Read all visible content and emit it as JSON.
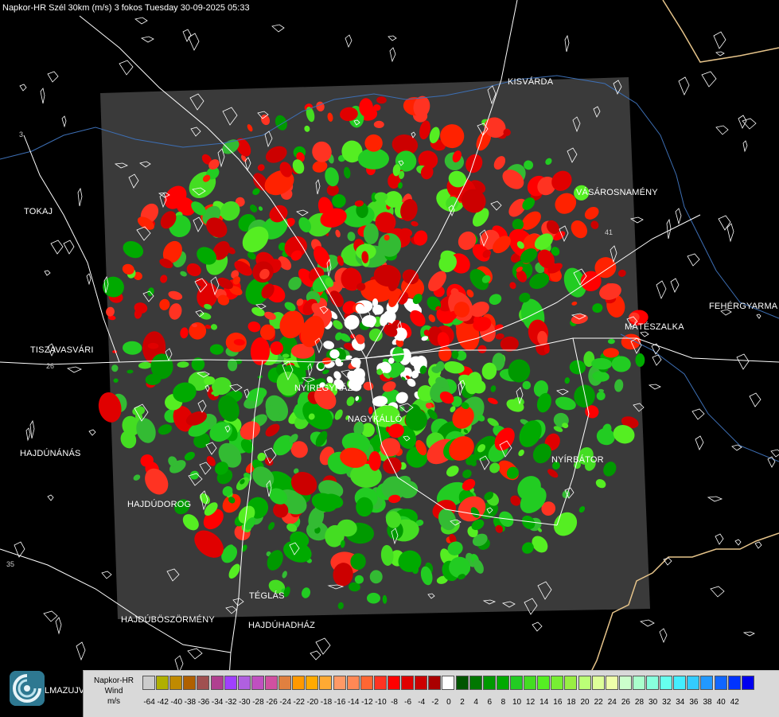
{
  "header": {
    "title": "Napkor-HR Szél 30km (m/s) 3 fokos Tuesday 30-09-2025 05:33"
  },
  "map": {
    "background_color": "#000000",
    "radar_box_color": "#3a3a3a",
    "border_color": "#e6c48a",
    "road_color": "#ffffff",
    "river_color": "#3d6fb5",
    "road_numbers": [
      "26",
      "41",
      "35",
      "3"
    ],
    "cities": [
      {
        "name": "KISVÁRDA"
      },
      {
        "name": "VÁSÁROSNAMÉNY"
      },
      {
        "name": "TOKAJ"
      },
      {
        "name": "FEHÉRGYARMA"
      },
      {
        "name": "MÁTÉSZALKA"
      },
      {
        "name": "TISZAVASVÁRI"
      },
      {
        "name": "NYÍREGYHÁZA"
      },
      {
        "name": "NAGYKÁLLÓ"
      },
      {
        "name": "HAJDÚNÁNÁS"
      },
      {
        "name": "NYÍRBÁTOR"
      },
      {
        "name": "HAJDÚDOROG"
      },
      {
        "name": "TÉGLÁS"
      },
      {
        "name": "HAJDÚBÖSZÖRMÉNY"
      },
      {
        "name": "HAJDÚHADHÁZ"
      }
    ]
  },
  "brand": {
    "logo_icon": "hungaromet-swirl-icon",
    "text": "LMAZUJVAR"
  },
  "legend": {
    "line1": "Napkor-HR",
    "line2": "Wind",
    "line3": "m/s",
    "colors": [
      "#cccccc",
      "#b0b000",
      "#c08a00",
      "#b06000",
      "#a05050",
      "#b04090",
      "#a040ff",
      "#b060e0",
      "#c050c0",
      "#d050a0",
      "#e08040",
      "#ff9900",
      "#ffaa00",
      "#ffaa33",
      "#ff9966",
      "#ff8855",
      "#ff6633",
      "#ff3322",
      "#ff0000",
      "#e00000",
      "#cc0000",
      "#aa0000",
      "#ffffff",
      "#005500",
      "#007700",
      "#009900",
      "#00aa00",
      "#22cc22",
      "#44dd22",
      "#55ee22",
      "#77ee33",
      "#99ee44",
      "#bbff77",
      "#ddff99",
      "#eeffaa",
      "#ccffcc",
      "#aaffcc",
      "#88ffdd",
      "#66ffee",
      "#44eeff",
      "#33ccff",
      "#2299ff",
      "#1166ff",
      "#0033ff",
      "#0000ee"
    ],
    "ticks": [
      "-64",
      "-42",
      "-40",
      "-38",
      "-36",
      "-34",
      "-32",
      "-30",
      "-28",
      "-26",
      "-24",
      "-22",
      "-20",
      "-18",
      "-16",
      "-14",
      "-12",
      "-10",
      "-8",
      "-6",
      "-4",
      "-2",
      "0",
      "2",
      "4",
      "6",
      "8",
      "10",
      "12",
      "14",
      "16",
      "18",
      "20",
      "22",
      "24",
      "26",
      "28",
      "30",
      "32",
      "34",
      "36",
      "38",
      "40",
      "42"
    ]
  }
}
